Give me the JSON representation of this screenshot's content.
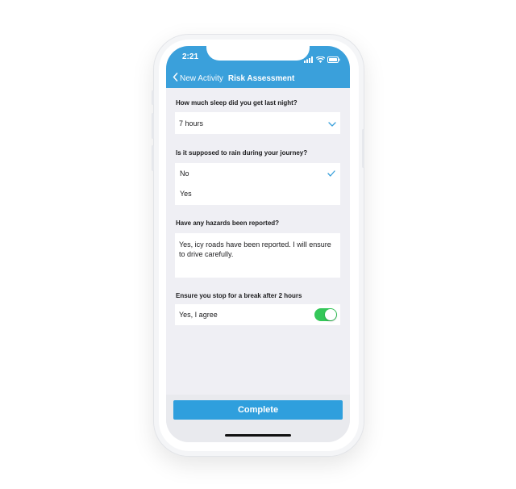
{
  "status_bar": {
    "time": "2:21"
  },
  "nav": {
    "back_label": "New Activity",
    "title": "Risk Assessment"
  },
  "questions": {
    "sleep": {
      "label": "How much sleep did you get last night?",
      "value": "7 hours"
    },
    "rain": {
      "label": "Is it supposed to rain during your journey?",
      "options": [
        "No",
        "Yes"
      ],
      "selected": "No"
    },
    "hazards": {
      "label": "Have any hazards been reported?",
      "value": "Yes, icy roads have been reported. I will ensure to drive carefully."
    },
    "break": {
      "label": "Ensure you stop for a break after 2 hours",
      "toggle_label": "Yes, I agree",
      "toggle_on": true
    }
  },
  "footer": {
    "complete_label": "Complete"
  },
  "colors": {
    "header": "#3aa0db",
    "accent": "#2f9fdd",
    "toggle_on": "#34c759",
    "background": "#efeff4"
  },
  "icons": [
    "back-chevron-icon",
    "signal-icon",
    "wifi-icon",
    "battery-icon",
    "chevron-down-icon",
    "checkmark-icon"
  ]
}
